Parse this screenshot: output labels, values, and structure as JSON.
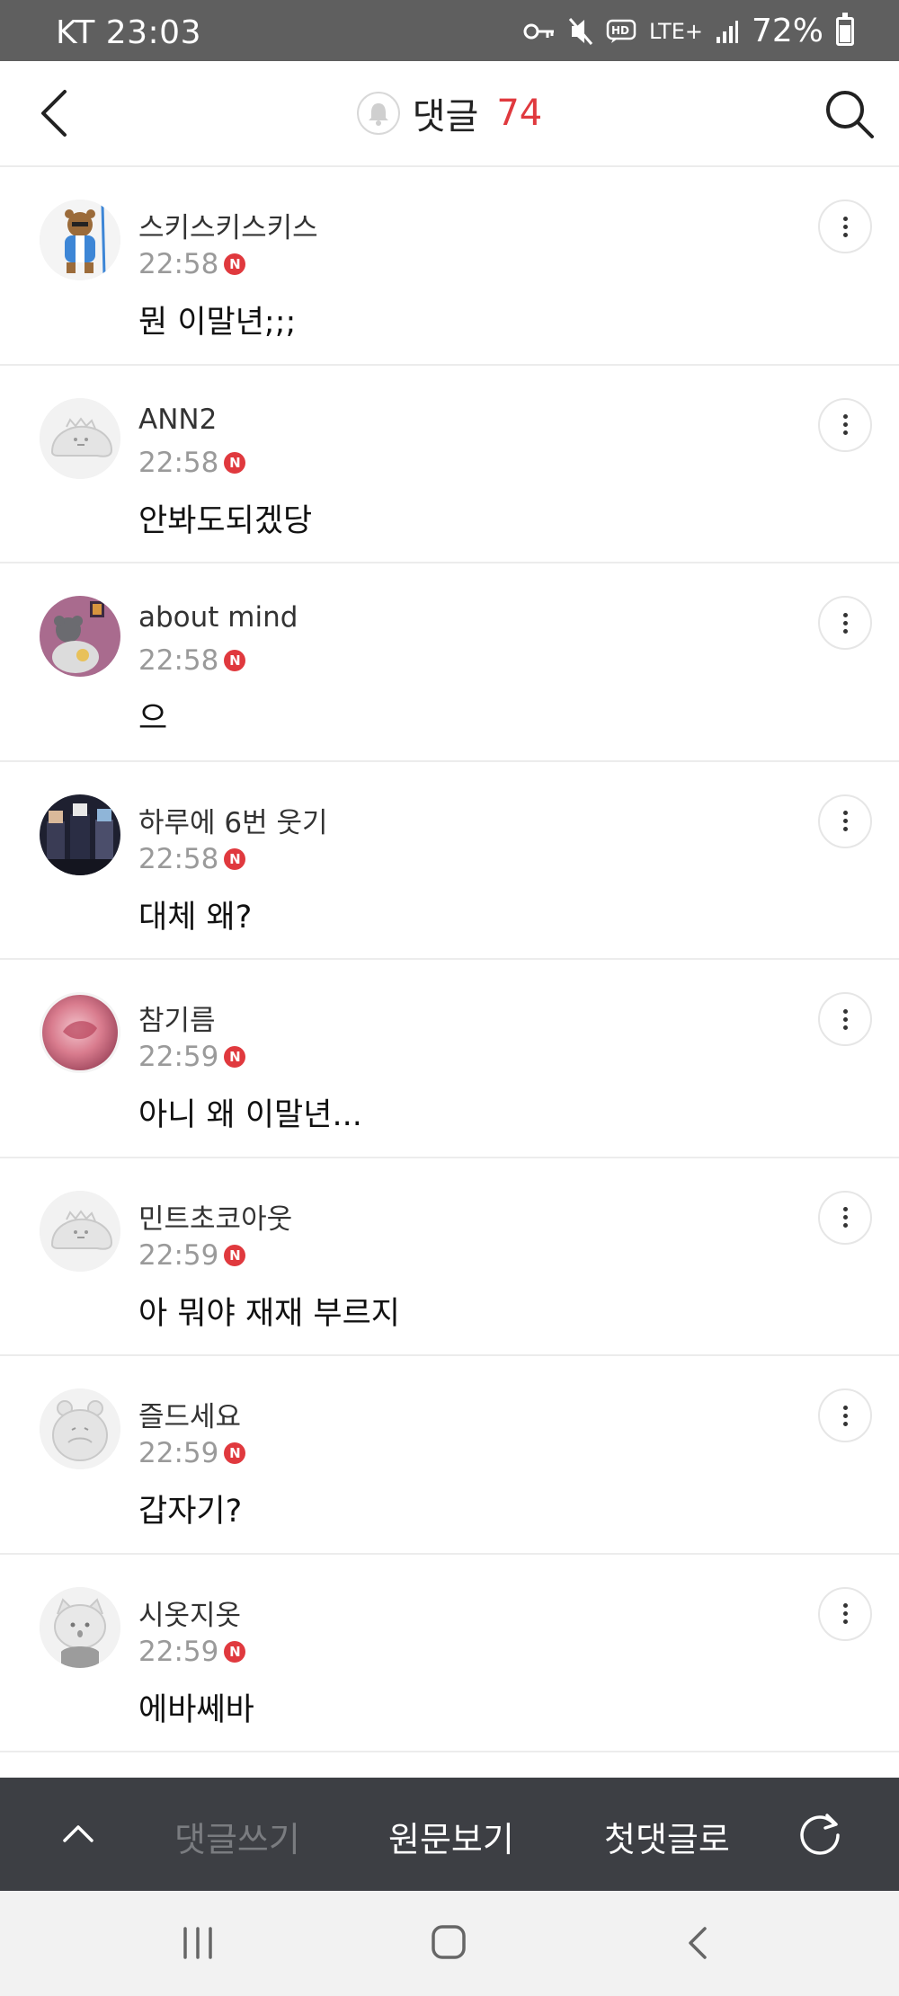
{
  "status_bar": {
    "carrier_time": "KT 23:03",
    "network": "LTE+",
    "battery": "72%",
    "icons": [
      "key-icon",
      "mute-icon",
      "hd-icon",
      "signal-icon",
      "battery-icon"
    ]
  },
  "header": {
    "title": "댓글",
    "count": "74",
    "accent_color": "#e0393e"
  },
  "comments": [
    {
      "author": "스키스키스키스",
      "time": "22:58",
      "badge": "N",
      "text": "뭔 이말년;;;"
    },
    {
      "author": "ANN2",
      "time": "22:58",
      "badge": "N",
      "text": "안봐도되겠당"
    },
    {
      "author": "about mind",
      "time": "22:58",
      "badge": "N",
      "text": "으"
    },
    {
      "author": "하루에 6번 웃기",
      "time": "22:58",
      "badge": "N",
      "text": "대체 왜?"
    },
    {
      "author": "참기름",
      "time": "22:59",
      "badge": "N",
      "text": "아니 왜 이말년..."
    },
    {
      "author": "민트초코아웃",
      "time": "22:59",
      "badge": "N",
      "text": "아 뭐야 재재 부르지"
    },
    {
      "author": "즐드세요",
      "time": "22:59",
      "badge": "N",
      "text": "갑자기?"
    },
    {
      "author": "시옷지옷",
      "time": "22:59",
      "badge": "N",
      "text": "에바쎄바"
    }
  ],
  "action_bar": {
    "write": "댓글쓰기",
    "original": "원문보기",
    "first": "첫댓글로"
  }
}
